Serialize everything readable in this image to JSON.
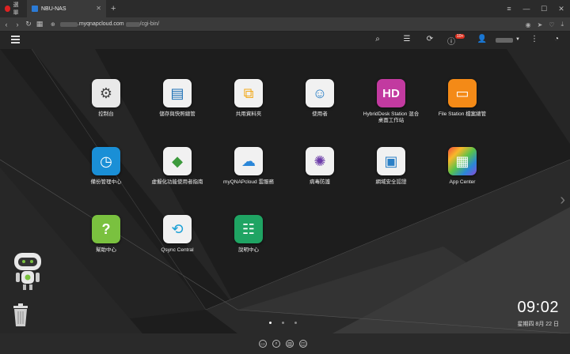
{
  "browser": {
    "tabs": [
      {
        "label": "選單"
      },
      {
        "label": "NBU-NAS"
      }
    ],
    "url": {
      "host": ".myqnapcloud.com",
      "path": "/cgi-bin/"
    }
  },
  "qts": {
    "notification_count": "10+"
  },
  "apps": [
    {
      "label": "控制台",
      "icon": "gear-icon",
      "color": "#e9e9e9"
    },
    {
      "label": "儲存與快照總管",
      "icon": "storage-icon",
      "color": "#f1f1f1"
    },
    {
      "label": "共用資料夾",
      "icon": "shared-folder-icon",
      "color": "#f1f1f1"
    },
    {
      "label": "使用者",
      "icon": "user-icon",
      "color": "#f1f1f1"
    },
    {
      "label": "HybridDesk Station 混合\n桌面工作站",
      "icon": "hd-icon",
      "color": "#c23aa0"
    },
    {
      "label": "File Station 檔案總管",
      "icon": "folder-icon",
      "color": "#f48a17"
    },
    {
      "label": "備份管理中心",
      "icon": "backup-icon",
      "color": "#1a8fd6"
    },
    {
      "label": "虛擬化功能使用者指南",
      "icon": "virtualization-icon",
      "color": "#f1f1f1"
    },
    {
      "label": "myQNAPcloud 雲服務",
      "icon": "cloud-icon",
      "color": "#f1f1f1"
    },
    {
      "label": "病毒防護",
      "icon": "antivirus-icon",
      "color": "#f1f1f1"
    },
    {
      "label": "網域安全認證",
      "icon": "domain-security-icon",
      "color": "#f1f1f1"
    },
    {
      "label": "App Center",
      "icon": "app-center-icon",
      "color": "#ffffff"
    },
    {
      "label": "幫助中心",
      "icon": "help-icon",
      "color": "#7ac13f"
    },
    {
      "label": "Qsync Central",
      "icon": "sync-icon",
      "color": "#f1f1f1"
    },
    {
      "label": "說明中心",
      "icon": "manual-icon",
      "color": "#1fa463"
    }
  ],
  "clock": {
    "time": "09:02",
    "date": "星期四 8月 22 日"
  }
}
